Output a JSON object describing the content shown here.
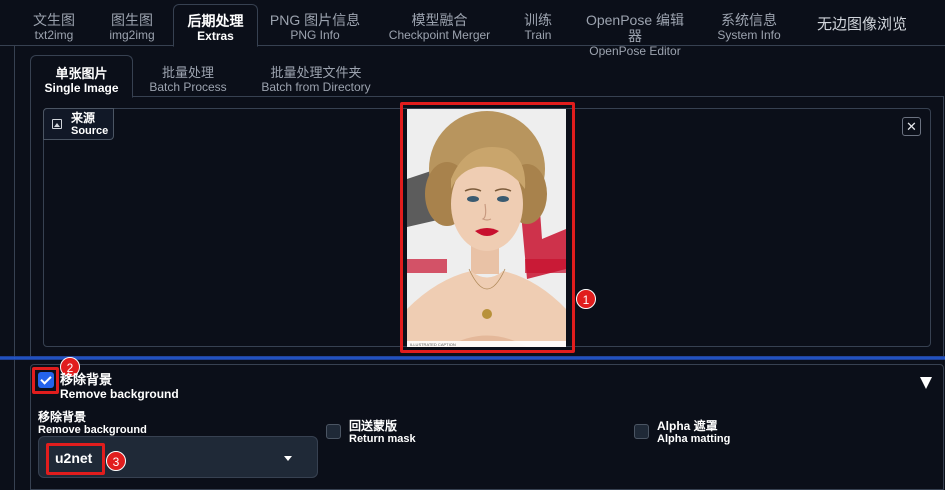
{
  "top_tabs": [
    {
      "zh": "文生图",
      "en": "txt2img"
    },
    {
      "zh": "图生图",
      "en": "img2img"
    },
    {
      "zh": "后期处理",
      "en": "Extras"
    },
    {
      "zh": "PNG 图片信息",
      "en": "PNG Info"
    },
    {
      "zh": "模型融合",
      "en": "Checkpoint Merger"
    },
    {
      "zh": "训练",
      "en": "Train"
    },
    {
      "zh": "OpenPose 编辑器",
      "en": "OpenPose Editor"
    },
    {
      "zh": "系统信息",
      "en": "System Info"
    },
    {
      "zh": "无边图像浏览"
    }
  ],
  "sub_tabs": [
    {
      "zh": "单张图片",
      "en": "Single Image"
    },
    {
      "zh": "批量处理",
      "en": "Batch Process"
    },
    {
      "zh": "批量处理文件夹",
      "en": "Batch from Directory"
    }
  ],
  "source": {
    "zh": "来源",
    "en": "Source",
    "icon": "image-icon",
    "close_glyph": "✕"
  },
  "photo_caption": "ILLUSTRATED CAPTION",
  "remove_bg": {
    "checked": true,
    "title_zh": "移除背景",
    "title_en": "Remove background",
    "model_label_zh": "移除背景",
    "model_label_en": "Remove background",
    "model_value": "u2net",
    "return_mask_zh": "回送蒙版",
    "return_mask_en": "Return mask",
    "alpha_matting_zh": "Alpha 遮罩",
    "alpha_matting_en": "Alpha matting"
  },
  "annotations": [
    "1",
    "2",
    "3"
  ],
  "colors": {
    "accent": "#2563eb",
    "highlight": "#e11d1d",
    "background": "#0b0f19"
  }
}
